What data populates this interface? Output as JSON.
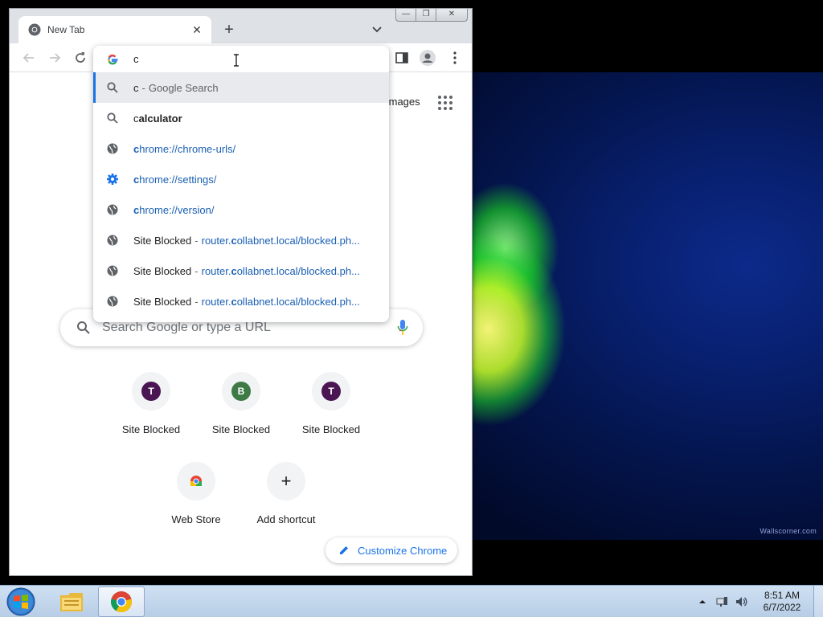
{
  "window": {
    "tab_title": "New Tab",
    "minimize_glyph": "—",
    "maximize_glyph": "❐",
    "close_glyph": "✕"
  },
  "toolbar": {
    "back_icon": "arrow-left-icon",
    "forward_icon": "arrow-right-icon",
    "reload_icon": "reload-icon"
  },
  "omnibox": {
    "typed_text": "c",
    "suggestions": [
      {
        "icon": "search-icon",
        "prefix": "c",
        "rest": "",
        "sep": "-",
        "desc": "Google Search",
        "selected": true
      },
      {
        "icon": "search-icon",
        "prefix": "c",
        "rest": "alculator"
      },
      {
        "icon": "globe-icon",
        "prefix": "c",
        "rest": "hrome://chrome-urls/"
      },
      {
        "icon": "gear-icon",
        "prefix": "c",
        "rest": "hrome://settings/"
      },
      {
        "icon": "globe-icon",
        "prefix": "c",
        "rest": "hrome://version/"
      },
      {
        "icon": "globe-icon",
        "title": "Site Blocked",
        "sep": "-",
        "url_a": "router.",
        "url_b": "c",
        "url_c": "ollabnet.local/blocked.ph..."
      },
      {
        "icon": "globe-icon",
        "title": "Site Blocked",
        "sep": "-",
        "url_a": "router.",
        "url_b": "c",
        "url_c": "ollabnet.local/blocked.ph..."
      },
      {
        "icon": "globe-icon",
        "title": "Site Blocked",
        "sep": "-",
        "url_a": "router.",
        "url_b": "c",
        "url_c": "ollabnet.local/blocked.ph..."
      }
    ]
  },
  "ntp": {
    "images_link": "Images",
    "search_placeholder": "Search Google or type a URL",
    "shortcuts": [
      {
        "letter": "T",
        "label": "Site Blocked",
        "color": "#4a1552"
      },
      {
        "letter": "B",
        "label": "Site Blocked",
        "color": "#3d7a45"
      },
      {
        "letter": "T",
        "label": "Site Blocked",
        "color": "#4a1552"
      },
      {
        "letter": "",
        "label": "Web Store"
      },
      {
        "letter": "+",
        "label": "Add shortcut"
      }
    ],
    "customize_label": "Customize Chrome"
  },
  "desktop": {
    "wallpaper_credit": "Wallscorner.com"
  },
  "taskbar": {
    "time": "8:51 AM",
    "date": "6/7/2022"
  },
  "colors": {
    "accent": "#1a73e8",
    "tab_strip": "#dee1e6"
  }
}
